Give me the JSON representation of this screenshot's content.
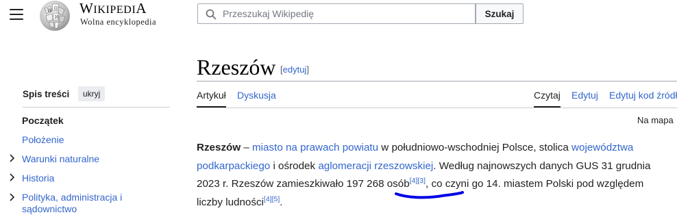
{
  "header": {
    "logo_wordmark": "Wikipedia",
    "logo_tagline": "Wolna encyklopedia",
    "search_placeholder": "Przeszukaj Wikipedię",
    "search_button": "Szukaj"
  },
  "page": {
    "title": "Rzeszów",
    "edit_link": "[edytuj]",
    "tabs_left": [
      "Artykuł",
      "Dyskusja"
    ],
    "tabs_right": [
      "Czytaj",
      "Edytuj",
      "Edytuj kod źródł"
    ],
    "map_link": "Na mapa"
  },
  "toc": {
    "title": "Spis treści",
    "hide_label": "ukryj",
    "items": [
      {
        "label": "Początek"
      },
      {
        "label": "Położenie"
      },
      {
        "label": "Warunki naturalne"
      },
      {
        "label": "Historia"
      },
      {
        "label": "Polityka, administracja i sądownictwo"
      }
    ]
  },
  "article": {
    "p1": "Rzeszów",
    "p2": " – ",
    "p3": "miasto na prawach powiatu",
    "p4": " w południowo-wschodniej Polsce, stolica ",
    "p5": "województwa podkarpackiego",
    "p6": " i ośrodek ",
    "p7": "aglomeracji rzeszowskiej",
    "p8": ". Według najnowszych danych GUS 31 grudnia 2023 r. Rzeszów zamieszkiwało 197 268 osób",
    "ref1": "[4]",
    "ref2": "[3]",
    "p9": ", co czyni go 14. miastem Polski pod względem liczby ludności",
    "ref3": "[4]",
    "ref4": "[5]",
    "p10": "."
  },
  "colors": {
    "link": "#3366cc",
    "text": "#202122",
    "annotation": "#0000e6"
  }
}
